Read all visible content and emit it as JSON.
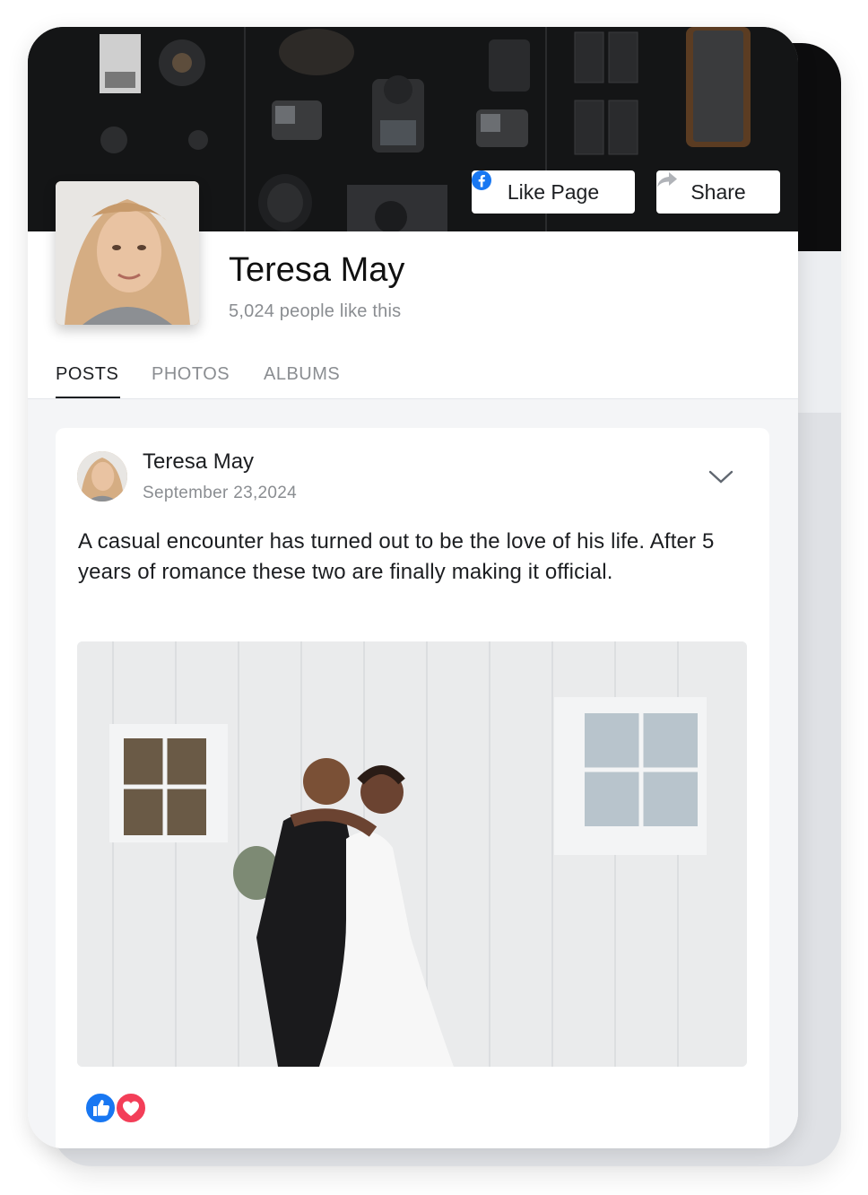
{
  "page": {
    "name": "Teresa May",
    "likes_text": "5,024 people like this"
  },
  "actions": {
    "like_label": "Like Page",
    "share_label": "Share"
  },
  "tabs": [
    {
      "label": "POSTS",
      "active": true
    },
    {
      "label": "PHOTOS",
      "active": false
    },
    {
      "label": "ALBUMS",
      "active": false
    }
  ],
  "post": {
    "author": "Teresa May",
    "date": "September 23,2024",
    "text": "A casual encounter has turned out to be the love of his life. After 5 years of romance these two are finally making it official.",
    "reactions": [
      "like-reaction-icon",
      "love-reaction-icon"
    ]
  },
  "colors": {
    "facebook_blue": "#1877f2",
    "love_red": "#f33e58",
    "cover_dark": "#151617"
  }
}
